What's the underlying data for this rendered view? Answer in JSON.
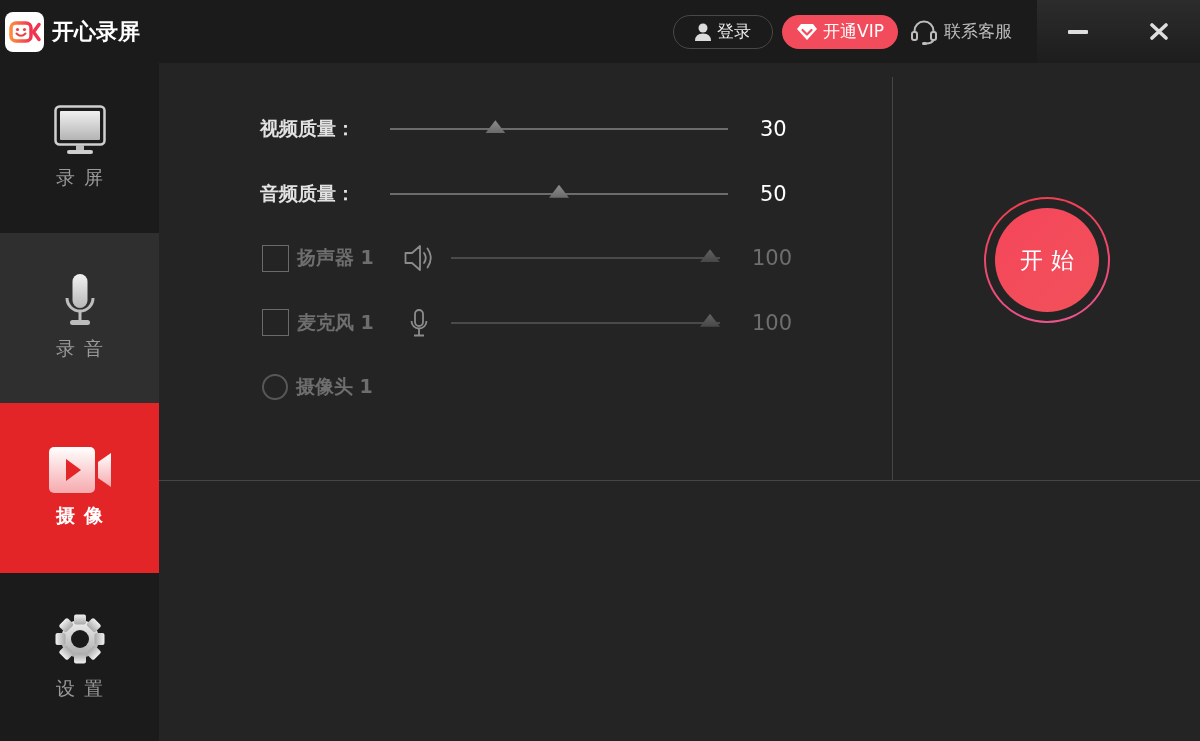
{
  "app": {
    "title": "开心录屏"
  },
  "header": {
    "login_button": "登录",
    "vip_button": "开通VIP",
    "support_link": "联系客服"
  },
  "sidebar": {
    "items": [
      {
        "kind": "screen",
        "label": "录屏",
        "selected": false,
        "hovered": false
      },
      {
        "kind": "audio",
        "label": "录音",
        "selected": false,
        "hovered": true
      },
      {
        "kind": "camera",
        "label": "摄像",
        "selected": true,
        "hovered": false
      },
      {
        "kind": "settings",
        "label": "设置",
        "selected": false,
        "hovered": false
      }
    ]
  },
  "settings": {
    "rows": [
      {
        "kind": "slider",
        "label": "视频质量：",
        "level": 0.3,
        "value": "30",
        "disabled": false
      },
      {
        "kind": "slider",
        "label": "音频质量：",
        "level": 0.5,
        "value": "50",
        "disabled": false
      },
      {
        "kind": "speaker",
        "label": "扬声器 1",
        "checked": false,
        "level": 1,
        "value": "100",
        "disabled": true
      },
      {
        "kind": "microphone",
        "label": "麦克风 1",
        "checked": false,
        "level": 1,
        "value": "100",
        "disabled": true
      },
      {
        "kind": "camera",
        "label": "摄像头 1",
        "selected": false,
        "disabled": true
      }
    ]
  },
  "start_button": {
    "label": "开始"
  }
}
